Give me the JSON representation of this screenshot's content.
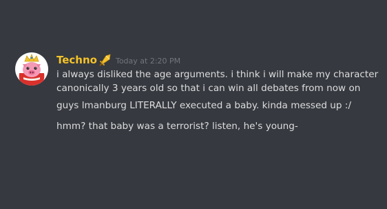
{
  "message": {
    "username": "Techno",
    "role_icon": "golden-sword-icon",
    "avatar": "pig-king-avatar",
    "timestamp": "Today at 2:20 PM",
    "lines": [
      "i always disliked the age arguments. i think i will make my character",
      "canonically 3 years old so that i can win all debates from now on",
      "guys lmanburg LITERALLY executed a baby. kinda messed up :/",
      "hmm? that baby was a terrorist? listen, he's young-"
    ]
  },
  "colors": {
    "background": "#36393f",
    "username": "#f5c22a",
    "text": "#dcddde",
    "timestamp": "#72767d"
  }
}
